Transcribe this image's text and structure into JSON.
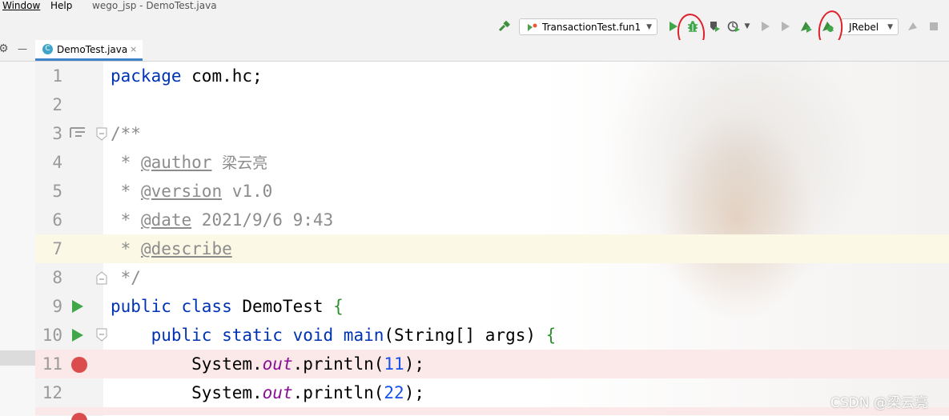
{
  "menu": {
    "items": [
      "Window",
      "Help"
    ],
    "project_title": "wego_jsp - DemoTest.java"
  },
  "toolbar": {
    "run_config": "TransactionTest.fun1",
    "jrebel": "JRebel",
    "icons": [
      "hammer-icon",
      "run-config-icon",
      "run-icon",
      "debug-icon",
      "coverage-icon",
      "profile-icon",
      "stop-icon",
      "jrebel-run-icon",
      "jrebel-debug-icon",
      "sync-icon",
      "stop-gray-icon"
    ]
  },
  "tab": {
    "label": "DemoTest.java",
    "close": "×",
    "file_icon": "C"
  },
  "left": {
    "gear": "⚙",
    "minimize": "—"
  },
  "editor": {
    "lines": [
      {
        "n": "1",
        "parts": [
          {
            "t": "package",
            "c": "kw"
          },
          {
            "t": " com.hc;",
            "c": ""
          }
        ]
      },
      {
        "n": "2",
        "parts": []
      },
      {
        "n": "3",
        "parts": [
          {
            "t": "/**",
            "c": "cmt"
          }
        ]
      },
      {
        "n": "4",
        "parts": [
          {
            "t": " * ",
            "c": "cmt"
          },
          {
            "t": "@author",
            "c": "tag"
          },
          {
            "t": " ",
            "c": "cmt"
          },
          {
            "t": "梁云亮",
            "c": "cjk"
          }
        ]
      },
      {
        "n": "5",
        "parts": [
          {
            "t": " * ",
            "c": "cmt"
          },
          {
            "t": "@version",
            "c": "tag"
          },
          {
            "t": " v1.0",
            "c": "cmt"
          }
        ]
      },
      {
        "n": "6",
        "parts": [
          {
            "t": " * ",
            "c": "cmt"
          },
          {
            "t": "@date",
            "c": "tag"
          },
          {
            "t": " 2021/9/6 9:43",
            "c": "cmt"
          }
        ]
      },
      {
        "n": "7",
        "parts": [
          {
            "t": " * ",
            "c": "cmt"
          },
          {
            "t": "@describe",
            "c": "tag"
          }
        ]
      },
      {
        "n": "8",
        "parts": [
          {
            "t": " */",
            "c": "cmt"
          }
        ]
      },
      {
        "n": "9",
        "parts": [
          {
            "t": "public class",
            "c": "kw"
          },
          {
            "t": " DemoTest ",
            "c": ""
          },
          {
            "t": "{",
            "c": "brk"
          }
        ]
      },
      {
        "n": "10",
        "parts": [
          {
            "t": "    public static void ",
            "c": "kw"
          },
          {
            "t": "main",
            "c": "kw"
          },
          {
            "t": "(String[] args) ",
            "c": ""
          },
          {
            "t": "{",
            "c": "brk"
          }
        ]
      },
      {
        "n": "11",
        "parts": [
          {
            "t": "        System.",
            "c": ""
          },
          {
            "t": "out",
            "c": "fld"
          },
          {
            "t": ".println(",
            "c": ""
          },
          {
            "t": "11",
            "c": "num"
          },
          {
            "t": ");",
            "c": ""
          }
        ]
      },
      {
        "n": "12",
        "parts": [
          {
            "t": "        System.",
            "c": ""
          },
          {
            "t": "out",
            "c": "fld"
          },
          {
            "t": ".println(",
            "c": ""
          },
          {
            "t": "22",
            "c": "num"
          },
          {
            "t": ");",
            "c": ""
          }
        ]
      }
    ]
  },
  "watermark": "CSDN @梁云亮",
  "colors": {
    "keyword": "#0033b3",
    "comment": "#8c8c8c",
    "field": "#871094",
    "number": "#1750eb",
    "breakpoint": "#db4c4c",
    "annotation_circle": "#e0202a"
  }
}
